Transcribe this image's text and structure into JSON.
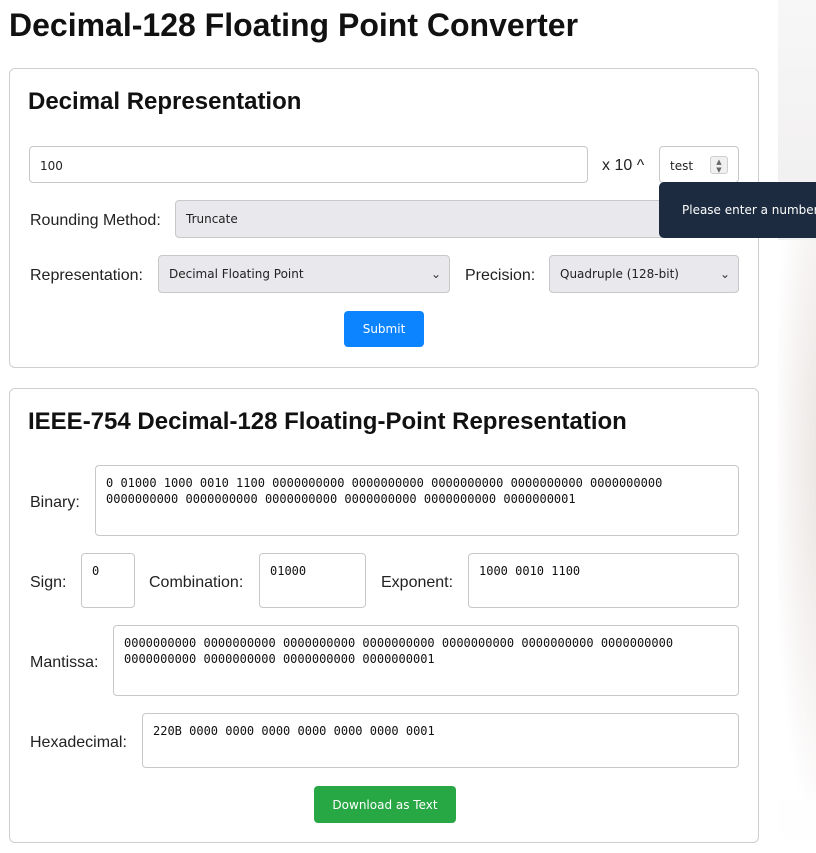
{
  "page": {
    "title": "Decimal-128 Floating Point Converter"
  },
  "decimal": {
    "heading": "Decimal Representation",
    "number_value": "100",
    "times_ten_label": "x 10 ^",
    "exponent_value": "test",
    "rounding_label": "Rounding Method:",
    "rounding_value": "Truncate",
    "representation_label": "Representation:",
    "representation_value": "Decimal Floating Point",
    "precision_label": "Precision:",
    "precision_value": "Quadruple (128-bit)",
    "submit_label": "Submit"
  },
  "validation_tooltip": "Please enter a number.",
  "ieee": {
    "heading": "IEEE-754 Decimal-128 Floating-Point Representation",
    "binary_label": "Binary:",
    "binary_value": "0 01000 1000 0010 1100 0000000000 0000000000 0000000000 0000000000 0000000000 0000000000 0000000000 0000000000 0000000000 0000000000 0000000001",
    "sign_label": "Sign:",
    "sign_value": "0",
    "combination_label": "Combination:",
    "combination_value": "01000",
    "exponent_label": "Exponent:",
    "exponent_value": "1000 0010 1100",
    "mantissa_label": "Mantissa:",
    "mantissa_value": "0000000000 0000000000 0000000000 0000000000 0000000000 0000000000 0000000000 0000000000 0000000000 0000000000 0000000001",
    "hex_label": "Hexadecimal:",
    "hex_value": "220B 0000 0000 0000 0000 0000 0000 0001",
    "download_label": "Download as Text"
  },
  "colors": {
    "primary": "#0d84ff",
    "success": "#28a745",
    "tooltip_bg": "#1c2b40"
  },
  "icons": [
    "chevron-down-icon",
    "spinner-arrows-icon"
  ]
}
